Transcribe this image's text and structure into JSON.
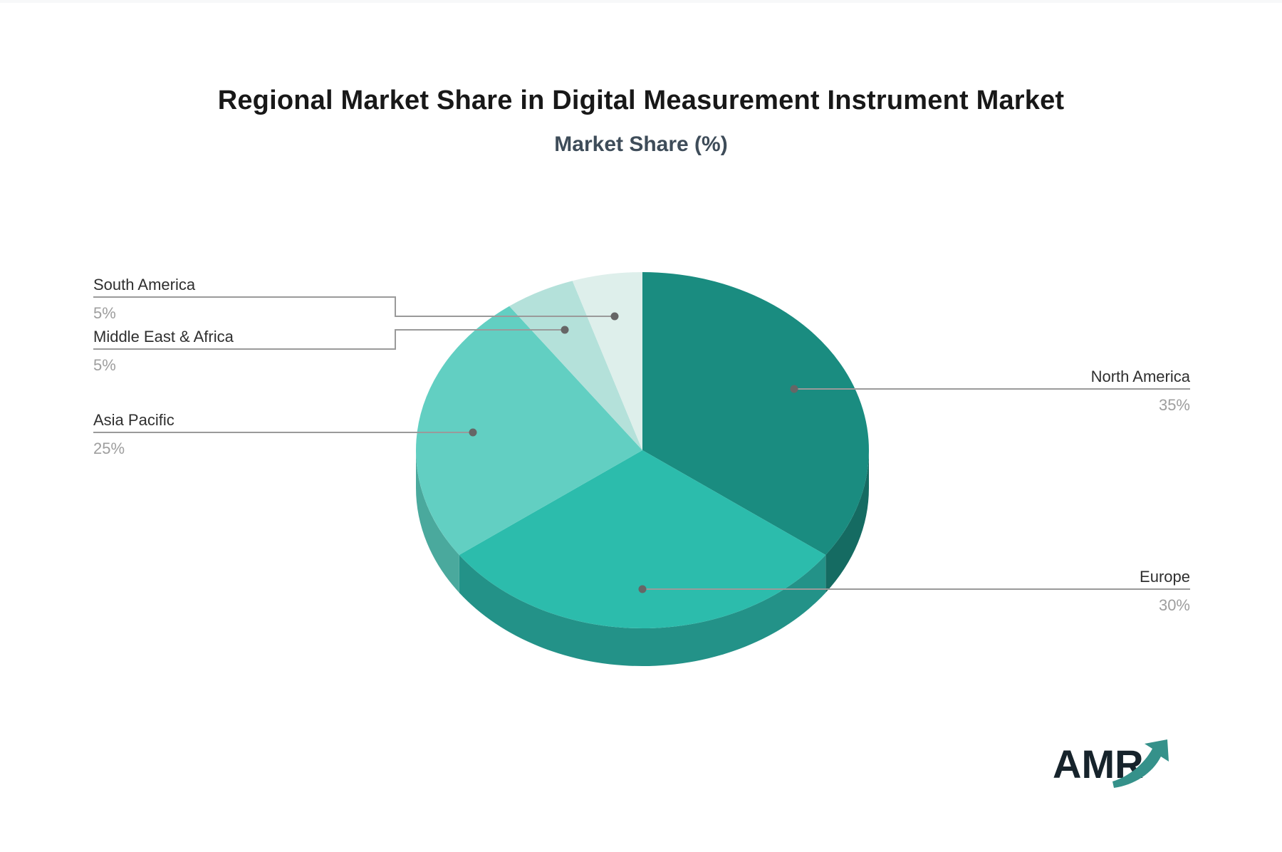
{
  "page": {
    "background_color": "#ffffff",
    "topbar_color": "#f7f8f9"
  },
  "header": {
    "title": "Regional Market Share in Digital Measurement Instrument Market",
    "subtitle": "Market Share (%)"
  },
  "chart_data": {
    "type": "pie",
    "style": "3d",
    "title": "Regional Market Share in Digital Measurement Instrument Market",
    "subtitle": "Market Share (%)",
    "unit": "%",
    "start_angle_deg": 0,
    "direction": "clockwise",
    "legend_position": "none",
    "categories": [
      "North America",
      "Europe",
      "Asia Pacific",
      "Middle East & Africa",
      "South America"
    ],
    "values": [
      35,
      30,
      25,
      5,
      5
    ],
    "value_labels": [
      "35%",
      "30%",
      "25%",
      "5%",
      "5%"
    ],
    "slice_colors": [
      "#1A8C80",
      "#2CBCAC",
      "#62CFC2",
      "#B4E1DA",
      "#DEEFEB"
    ],
    "slice_wall_colors": [
      "#156B62",
      "#239288",
      "#4AA99D",
      "#8FC9C0",
      "#BCD9D4"
    ]
  },
  "connectors": {
    "line_color": "#9A9A9A",
    "dot_color": "#666666",
    "label_color": "#2F2F2F",
    "value_color": "#9E9E9E"
  },
  "logo": {
    "text": "AMR",
    "text_color": "#16232B",
    "arrow_color": "#35918A"
  }
}
